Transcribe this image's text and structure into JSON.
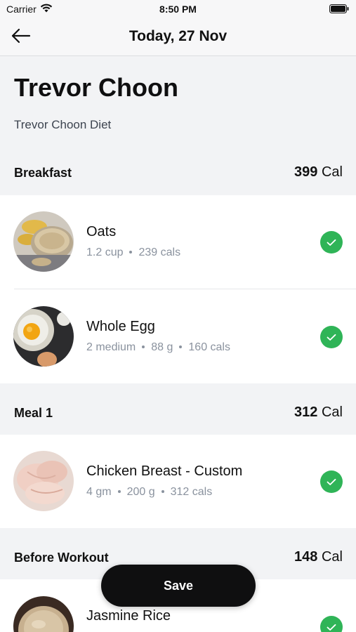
{
  "status_bar": {
    "carrier": "Carrier",
    "time": "8:50 PM"
  },
  "nav": {
    "title": "Today, 27 Nov"
  },
  "header": {
    "name": "Trevor Choon",
    "diet": "Trevor Choon Diet"
  },
  "unit": "Cal",
  "sections": [
    {
      "name": "Breakfast",
      "calories": "399",
      "items": [
        {
          "name": "Oats",
          "meta": [
            "1.2 cup",
            "239 cals"
          ],
          "icon": "oats-photo",
          "checked": true
        },
        {
          "name": "Whole Egg",
          "meta": [
            "2 medium",
            "88 g",
            "160 cals"
          ],
          "icon": "egg-photo",
          "checked": true
        }
      ]
    },
    {
      "name": "Meal 1",
      "calories": "312",
      "items": [
        {
          "name": "Chicken Breast - Custom",
          "meta": [
            "4 gm",
            "200 g",
            "312 cals"
          ],
          "icon": "chicken-photo",
          "checked": true
        }
      ]
    },
    {
      "name": "Before Workout",
      "calories": "148",
      "items": [
        {
          "name": "Jasmine Rice",
          "meta": [],
          "icon": "rice-photo",
          "checked": true
        }
      ]
    }
  ],
  "save_label": "Save",
  "colors": {
    "check": "#2fb457",
    "save_bg": "#0f0f10",
    "meta_text": "#8a929e",
    "section_bg": "#f2f3f5"
  }
}
